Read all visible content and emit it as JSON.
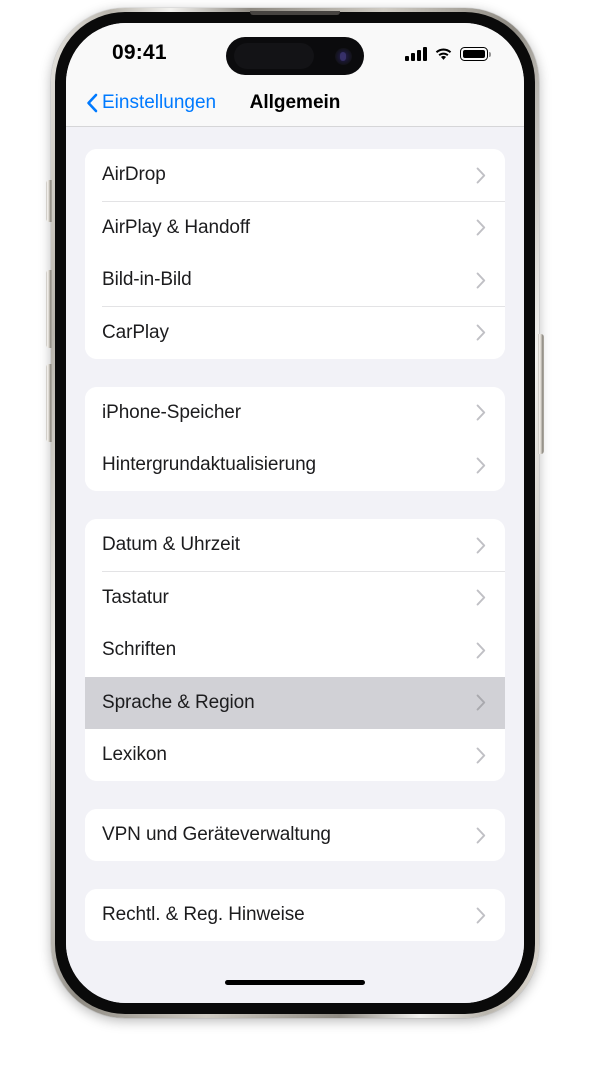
{
  "status_bar": {
    "time": "09:41",
    "cellular_icon": "cellular-signal-icon",
    "cellular_bars": 4,
    "wifi_icon": "wifi-icon",
    "battery_icon": "battery-full-icon"
  },
  "nav_bar": {
    "back_label": "Einstellungen",
    "back_icon": "chevron-left-icon",
    "title": "Allgemein",
    "accent_color": "#007AFF"
  },
  "colors": {
    "background": "#F2F2F7",
    "card": "#FFFFFF",
    "selected_row": "#D1D1D6",
    "separator": "#E3E3E5",
    "chevron": "#C7C7CC",
    "label": "#1C1C1E",
    "accent": "#007AFF"
  },
  "groups": [
    {
      "rows": [
        {
          "label": "AirDrop",
          "chevron_icon": "chevron-right-icon",
          "selected": false
        },
        {
          "label": "AirPlay & Handoff",
          "chevron_icon": "chevron-right-icon",
          "selected": false
        },
        {
          "label": "Bild-in-Bild",
          "chevron_icon": "chevron-right-icon",
          "selected": false
        },
        {
          "label": "CarPlay",
          "chevron_icon": "chevron-right-icon",
          "selected": false
        }
      ]
    },
    {
      "rows": [
        {
          "label": "iPhone-Speicher",
          "chevron_icon": "chevron-right-icon",
          "selected": false
        },
        {
          "label": "Hintergrundaktualisierung",
          "chevron_icon": "chevron-right-icon",
          "selected": false
        }
      ]
    },
    {
      "rows": [
        {
          "label": "Datum & Uhrzeit",
          "chevron_icon": "chevron-right-icon",
          "selected": false
        },
        {
          "label": "Tastatur",
          "chevron_icon": "chevron-right-icon",
          "selected": false
        },
        {
          "label": "Schriften",
          "chevron_icon": "chevron-right-icon",
          "selected": false
        },
        {
          "label": "Sprache & Region",
          "chevron_icon": "chevron-right-icon",
          "selected": true
        },
        {
          "label": "Lexikon",
          "chevron_icon": "chevron-right-icon",
          "selected": false
        }
      ]
    },
    {
      "rows": [
        {
          "label": "VPN und Geräteverwaltung",
          "chevron_icon": "chevron-right-icon",
          "selected": false
        }
      ]
    },
    {
      "rows": [
        {
          "label": "Rechtl. & Reg. Hinweise",
          "chevron_icon": "chevron-right-icon",
          "selected": false
        }
      ]
    }
  ],
  "device": {
    "action_button": "action-button",
    "volume_up_button": "volume-up-button",
    "volume_down_button": "volume-down-button",
    "side_button": "side-power-button",
    "home_indicator": "home-indicator"
  }
}
